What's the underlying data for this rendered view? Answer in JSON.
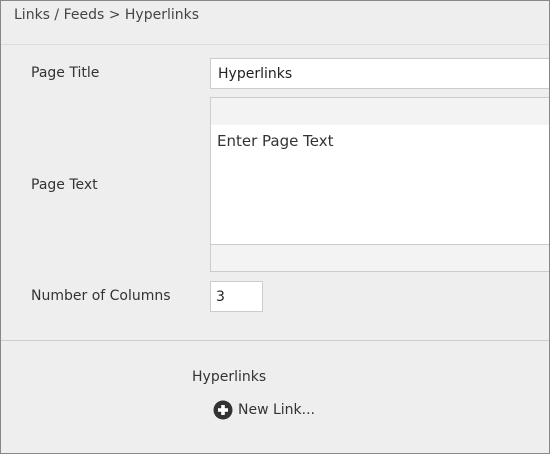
{
  "breadcrumb": {
    "text": "Links / Feeds > Hyperlinks"
  },
  "form": {
    "page_title": {
      "label": "Page Title",
      "value": "Hyperlinks"
    },
    "page_text": {
      "label": "Page Text",
      "body_text": "Enter Page Text"
    },
    "columns": {
      "label": "Number of Columns",
      "value": "3"
    }
  },
  "hyperlinks_section": {
    "heading": "Hyperlinks",
    "new_link_label": "New Link...",
    "new_link_icon": "plus-circle-icon"
  },
  "colors": {
    "panel_background": "#eeeeee",
    "border": "#cccccc",
    "text": "#333333",
    "icon": "#333333"
  }
}
